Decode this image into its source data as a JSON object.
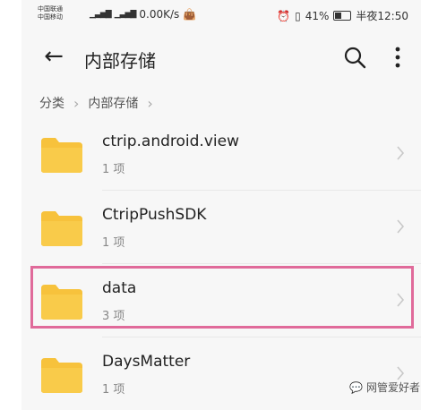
{
  "status_bar": {
    "carrier_1": "中国联通",
    "carrier_2": "中国移动",
    "speed": "0.00K/s",
    "battery": "41%",
    "time": "半夜12:50"
  },
  "app_bar": {
    "title": "内部存储"
  },
  "breadcrumb": [
    "分类",
    "内部存储"
  ],
  "files": [
    {
      "name": "ctrip.android.view",
      "count": "1 项"
    },
    {
      "name": "CtripPushSDK",
      "count": "1 项"
    },
    {
      "name": "data",
      "count": "3 项"
    },
    {
      "name": "DaysMatter",
      "count": "1 项"
    }
  ],
  "watermark": "网管爱好者",
  "colors": {
    "folder": "#f7c23c",
    "highlight": "#e06a9a"
  }
}
